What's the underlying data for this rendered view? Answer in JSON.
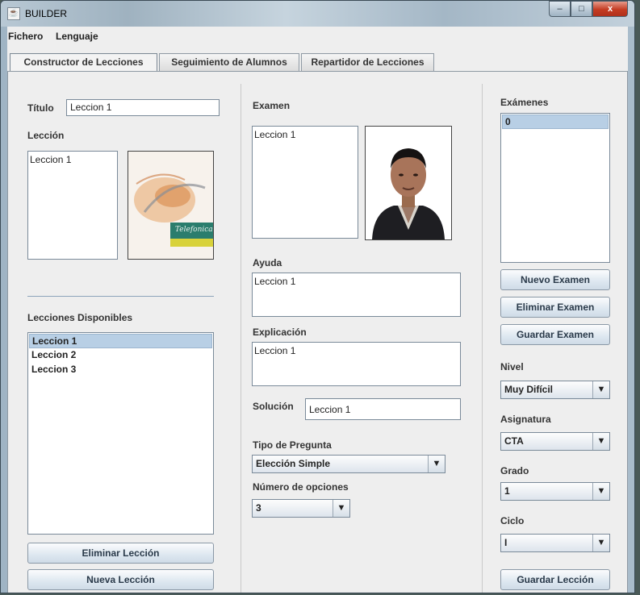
{
  "window": {
    "title": "BUILDER",
    "buttons": {
      "minimize": "–",
      "maximize": "□",
      "close": "x"
    }
  },
  "menu": [
    "Fichero",
    "Lenguaje"
  ],
  "tabs": [
    "Constructor de Lecciones",
    "Seguimiento de Alumnos",
    "Repartidor de Lecciones"
  ],
  "left": {
    "titulo_label": "Título",
    "titulo_value": "Leccion 1",
    "leccion_label": "Lección",
    "leccion_text": "Leccion 1",
    "cover_text": "Telefonica",
    "disponibles_label": "Lecciones Disponibles",
    "lessons": [
      "Leccion 1",
      "Leccion 2",
      "Leccion 3"
    ],
    "eliminar_btn": "Eliminar Lección",
    "nueva_btn": "Nueva Lección"
  },
  "middle": {
    "examen_label": "Examen",
    "examen_text": "Leccion 1",
    "ayuda_label": "Ayuda",
    "ayuda_text": "Leccion 1",
    "explicacion_label": "Explicación",
    "explicacion_text": "Leccion 1",
    "solucion_label": "Solución",
    "solucion_value": "Leccion 1",
    "tipo_label": "Tipo de Pregunta",
    "tipo_value": "Elección Simple",
    "num_label": "Número de opciones",
    "num_value": "3"
  },
  "right": {
    "examenes_label": "Exámenes",
    "examenes": [
      "0"
    ],
    "nuevo_btn": "Nuevo Examen",
    "eliminar_btn": "Eliminar Examen",
    "guardar_btn": "Guardar Examen",
    "nivel_label": "Nivel",
    "nivel_value": "Muy Difícil",
    "asignatura_label": "Asignatura",
    "asignatura_value": "CTA",
    "grado_label": "Grado",
    "grado_value": "1",
    "ciclo_label": "Ciclo",
    "ciclo_value": "I",
    "guardar_leccion_btn": "Guardar Lección"
  },
  "icons": {
    "dropdown": "▼"
  }
}
